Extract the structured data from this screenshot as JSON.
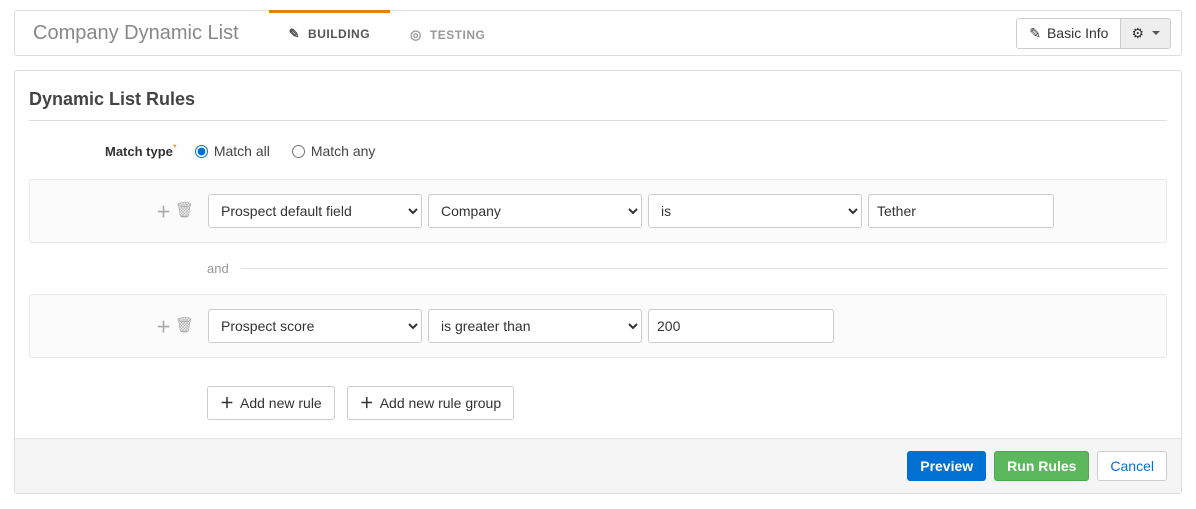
{
  "header": {
    "page_title": "Company Dynamic List",
    "tabs": [
      {
        "label": "BUILDING",
        "active": true
      },
      {
        "label": "TESTING",
        "active": false
      }
    ],
    "basic_info_label": "Basic Info"
  },
  "rules_panel": {
    "title": "Dynamic List Rules",
    "match_type_label": "Match type",
    "match_all_label": "Match all",
    "match_any_label": "Match any",
    "match_selected": "all",
    "and_label": "and",
    "rules": [
      {
        "field_type": "Prospect default field",
        "field_name": "Company",
        "operator": "is",
        "value": "Tether"
      },
      {
        "field_type": "Prospect score",
        "operator": "is greater than",
        "value": "200"
      }
    ],
    "add_rule_label": "Add new rule",
    "add_group_label": "Add new rule group"
  },
  "footer": {
    "preview_label": "Preview",
    "run_label": "Run Rules",
    "cancel_label": "Cancel"
  }
}
